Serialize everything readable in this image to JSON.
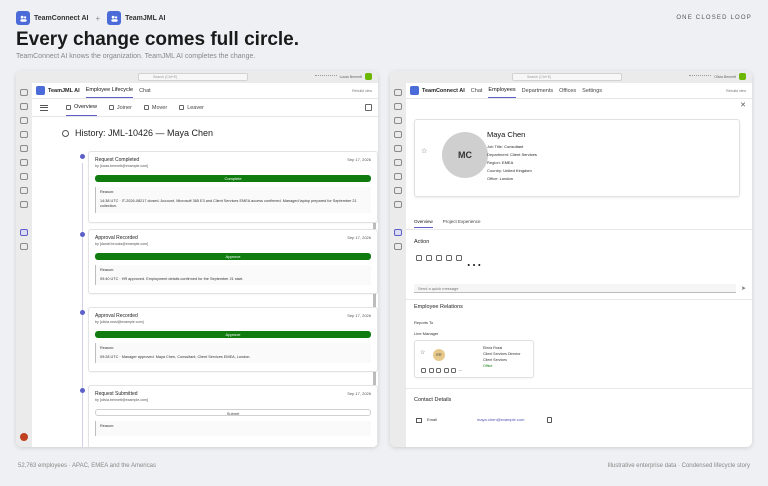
{
  "header": {
    "brand_left": "TeamConnect AI",
    "plus": "+",
    "brand_right": "TeamJML AI",
    "tagline": "ONE CLOSED LOOP",
    "headline": "Every change comes full circle.",
    "subhead": "TeamConnect AI knows the organization. TeamJML AI completes the change."
  },
  "footer": {
    "left": "52,763 employees · APAC, EMEA and the Americas",
    "right": "Illustrative enterprise data · Condensed lifecycle story"
  },
  "left_window": {
    "search_placeholder": "Search (Ctrl+E)",
    "user_label": "Lucas Bennett",
    "app_name": "TeamJML AI",
    "tabs": [
      {
        "label": "Employee Lifecycle",
        "active": true
      },
      {
        "label": "Chat",
        "active": false
      }
    ],
    "appbar_right": "Rebuild view",
    "subtabs": [
      {
        "label": "Overview",
        "active": true
      },
      {
        "label": "Joiner",
        "active": false
      },
      {
        "label": "Mover",
        "active": false
      },
      {
        "label": "Leaver",
        "active": false
      }
    ],
    "history_title": "History: JML-10426 — Maya Chen",
    "events": [
      {
        "title": "Request Completed",
        "by": "by [lucas.bennett@example.com]",
        "date": "Sep 17, 2026",
        "status": "Complete",
        "reason_label": "Reason:",
        "reason": "14:38 UTC · IT-2026-08217 closed. Account, Microsoft 365 E3 and Client Services EMEA access confirmed. Managed laptop prepared for September 21 collection."
      },
      {
        "title": "Approval Recorded",
        "by": "by [daniel.brooks@example.com]",
        "date": "Sep 17, 2026",
        "status": "Approve",
        "reason_label": "Reason:",
        "reason": "09:40 UTC · HR approved. Employment details confirmed for the September 21 start."
      },
      {
        "title": "Approval Recorded",
        "by": "by [olivia.rossi@example.com]",
        "date": "Sep 17, 2026",
        "status": "Approve",
        "reason_label": "Reason:",
        "reason": "09:28 UTC · Manager approved. Maya Chen, Consultant, Client Services EMEA, London."
      },
      {
        "title": "Request Submitted",
        "by": "by [olivia.bennett@example.com]",
        "date": "Sep 17, 2026",
        "status": "Submit",
        "reason_label": "Reason:",
        "reason": ""
      }
    ]
  },
  "right_window": {
    "search_placeholder": "Search (Ctrl+E)",
    "user_label": "Olivia Bennett",
    "app_name": "TeamConnect AI",
    "tabs": [
      {
        "label": "Chat",
        "active": false
      },
      {
        "label": "Employees",
        "active": true
      },
      {
        "label": "Departments",
        "active": false
      },
      {
        "label": "Offices",
        "active": false
      },
      {
        "label": "Settings",
        "active": false
      }
    ],
    "appbar_right": "Rebuild view",
    "close": "✕",
    "profile": {
      "initials": "MC",
      "name": "Maya Chen",
      "job_title_label": "Job Title:",
      "job_title": "Consultant",
      "department_label": "Department:",
      "department": "Client Services",
      "region_label": "Region:",
      "region": "EMEA",
      "country_label": "Country:",
      "country": "United Kingdom",
      "office_label": "Office:",
      "office": "London"
    },
    "tabs2": [
      {
        "label": "Overview",
        "active": true
      },
      {
        "label": "Project Experience",
        "active": false
      }
    ],
    "action_title": "Action",
    "quick_message_placeholder": "Send a quick message",
    "relations_title": "Employee Relations",
    "reports_to": "Reports To",
    "line_manager": "Line Manager",
    "manager": {
      "initials": "ER",
      "name": "Elena Rossi",
      "title": "Client Services Director",
      "department": "Client Services",
      "status": "Office"
    },
    "contact_title": "Contact Details",
    "email_label": "Email",
    "email": "maya.chen@example.com"
  },
  "colors": {
    "accent": "#5b5fc7",
    "brand": "#4a6bd8",
    "success": "#107c10"
  }
}
